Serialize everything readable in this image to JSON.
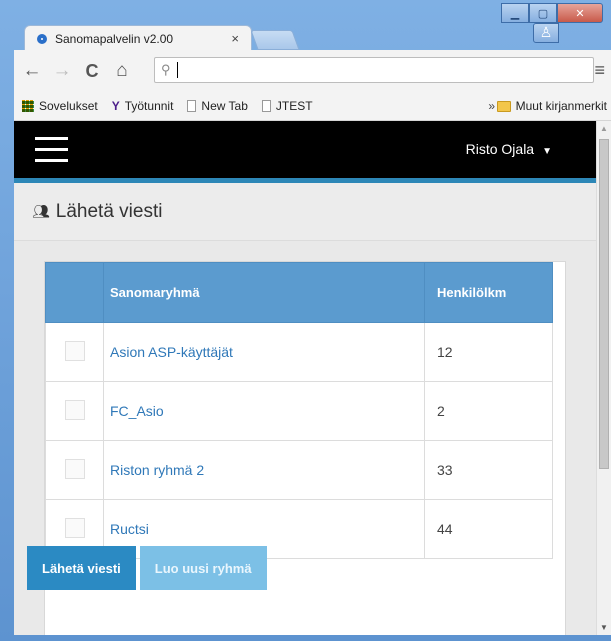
{
  "browser": {
    "tab_title": "Sanomapalvelin v2.00",
    "tab_close": "×",
    "omnibox_value": "",
    "bookmarks": [
      {
        "label": "Sovelukset",
        "icon": "apps-icon"
      },
      {
        "label": "Työtunnit",
        "icon": "yahoo-icon"
      },
      {
        "label": "New Tab",
        "icon": "page-icon"
      },
      {
        "label": "JTEST",
        "icon": "page-icon"
      }
    ],
    "bookmarks_overflow": "»",
    "other_bookmarks": "Muut kirjanmerkit"
  },
  "app": {
    "user_name": "Risto Ojala",
    "page_title": "Lähetä viesti",
    "table": {
      "headers": [
        "",
        "Sanomaryhmä",
        "Henkilölkm"
      ],
      "rows": [
        {
          "name": "Asion ASP-käyttäjät",
          "count": "12"
        },
        {
          "name": "FC_Asio",
          "count": "2"
        },
        {
          "name": "Riston ryhmä 2",
          "count": "33"
        },
        {
          "name": "Ructsi",
          "count": "44"
        }
      ]
    },
    "buttons": {
      "send": "Lähetä viesti",
      "new_group": "Luo uusi ryhmä"
    }
  },
  "colors": {
    "appbar": "#000000",
    "appbar_accent": "#2d87b7",
    "table_header": "#5b9bcf",
    "link": "#2f78b8",
    "primary_button": "#2b8ac3",
    "secondary_button": "#7cc0e6"
  }
}
